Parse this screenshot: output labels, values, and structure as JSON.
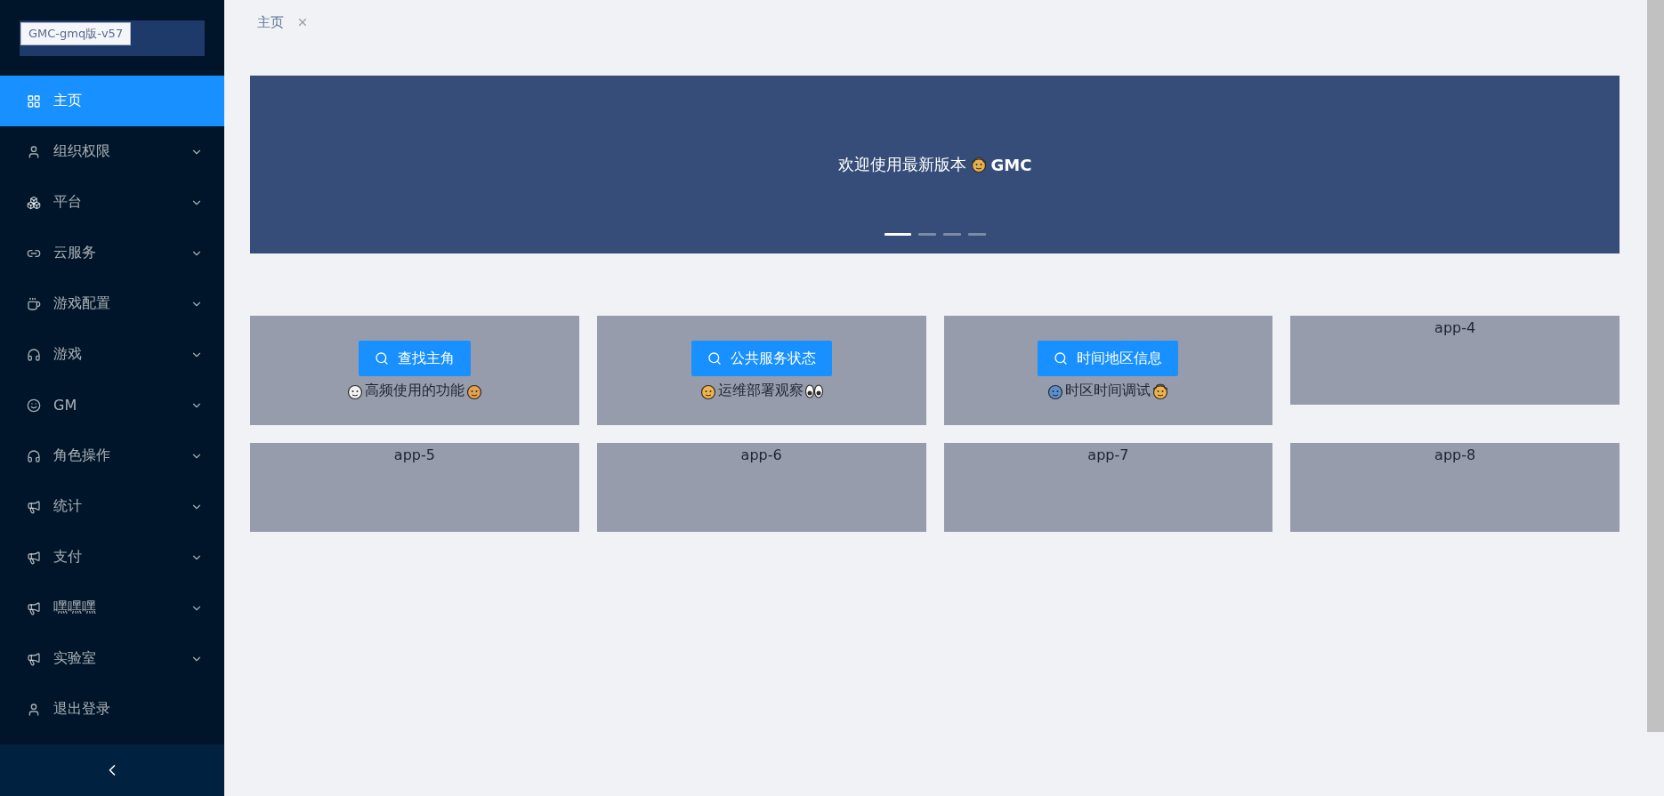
{
  "logo": {
    "label": "GMC-gmq版-v57"
  },
  "sidebar": {
    "items": [
      {
        "label": "主页",
        "selected": true,
        "submenu": false
      },
      {
        "label": "组织权限",
        "selected": false,
        "submenu": true
      },
      {
        "label": "平台",
        "selected": false,
        "submenu": true
      },
      {
        "label": "云服务",
        "selected": false,
        "submenu": true
      },
      {
        "label": "游戏配置",
        "selected": false,
        "submenu": true
      },
      {
        "label": "游戏",
        "selected": false,
        "submenu": true
      },
      {
        "label": "GM",
        "selected": false,
        "submenu": true
      },
      {
        "label": "角色操作",
        "selected": false,
        "submenu": true
      },
      {
        "label": "统计",
        "selected": false,
        "submenu": true
      },
      {
        "label": "支付",
        "selected": false,
        "submenu": true
      },
      {
        "label": "嘿嘿嘿",
        "selected": false,
        "submenu": true
      },
      {
        "label": "实验室",
        "selected": false,
        "submenu": true
      },
      {
        "label": "退出登录",
        "selected": false,
        "submenu": false
      }
    ]
  },
  "tabs": [
    {
      "label": "主页",
      "selected": true,
      "closable": true
    }
  ],
  "banner": {
    "title": "欢迎使用最新版本",
    "brand": "GMC",
    "dots": [
      {
        "selected": true
      },
      {
        "selected": false
      },
      {
        "selected": false
      },
      {
        "selected": false
      }
    ]
  },
  "cards": [
    {
      "kind": "feature",
      "button": "查找主角",
      "caption": "高频使用的功能"
    },
    {
      "kind": "feature",
      "button": "公共服务状态",
      "caption": "运维部署观察"
    },
    {
      "kind": "feature",
      "button": "时间地区信息",
      "caption": "时区时间调试"
    },
    {
      "kind": "plain",
      "title": "app-4"
    },
    {
      "kind": "plain",
      "title": "app-5"
    },
    {
      "kind": "plain",
      "title": "app-6"
    },
    {
      "kind": "plain",
      "title": "app-7"
    },
    {
      "kind": "plain",
      "title": "app-8"
    }
  ]
}
